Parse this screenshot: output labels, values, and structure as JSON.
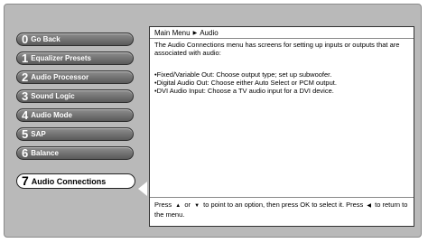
{
  "menu": {
    "items": [
      {
        "num": "0",
        "label": "Go Back"
      },
      {
        "num": "1",
        "label": "Equalizer Presets"
      },
      {
        "num": "2",
        "label": "Audio Processor"
      },
      {
        "num": "3",
        "label": "Sound Logic"
      },
      {
        "num": "4",
        "label": "Audio Mode"
      },
      {
        "num": "5",
        "label": "SAP"
      },
      {
        "num": "6",
        "label": "Balance"
      },
      {
        "num": "7",
        "label": "Audio Connections"
      }
    ],
    "selected_index": 7
  },
  "panel": {
    "breadcrumb": {
      "root": "Main Menu",
      "current": "Audio"
    },
    "description": "The Audio Connections menu has screens for setting up inputs or outputs that are associated with audio:",
    "options": [
      "•Fixed/Variable Out: Choose output type; set up subwoofer.",
      "•Digital Audio Out: Choose either Auto Select or PCM output.",
      "•DVI Audio Input: Choose a TV audio input for a DVI device."
    ],
    "help": {
      "part1": "Press",
      "part2": "or",
      "part3": "to point to an option, then press OK to select it. Press",
      "part4": "to return to the menu."
    }
  },
  "icons": {
    "breadcrumb_separator": "triangle-right-icon",
    "up": "arrow-up-icon",
    "down": "arrow-down-icon",
    "left": "arrow-left-icon"
  }
}
